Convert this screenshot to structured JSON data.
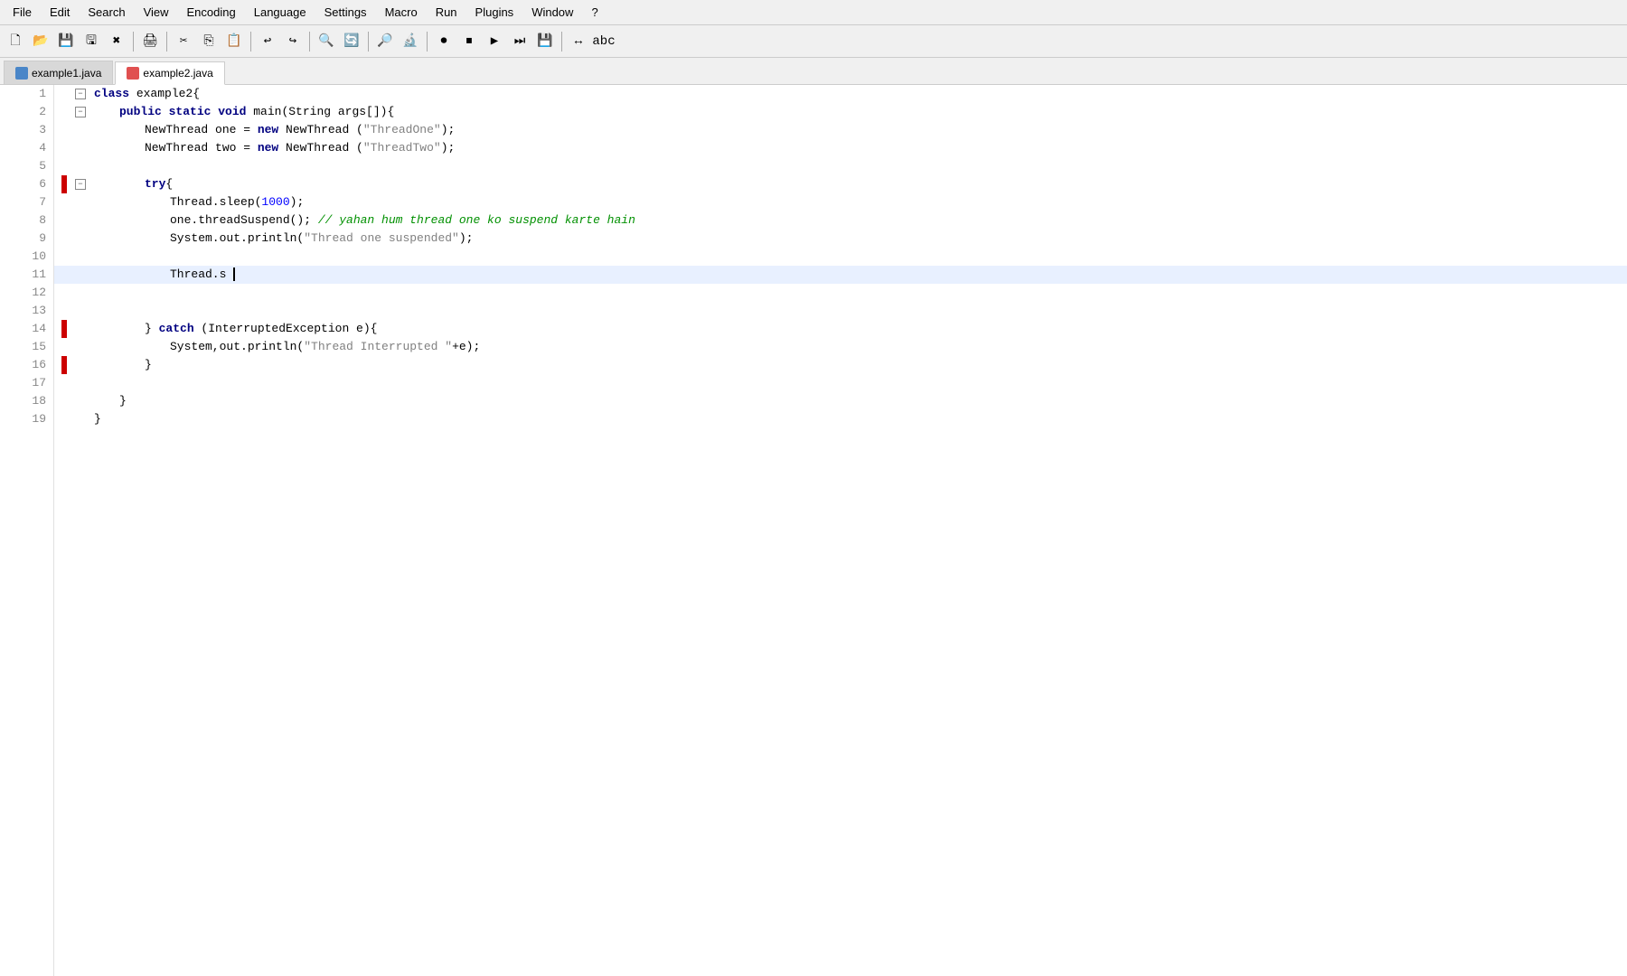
{
  "menubar": {
    "items": [
      "File",
      "Edit",
      "Search",
      "View",
      "Encoding",
      "Language",
      "Settings",
      "Macro",
      "Run",
      "Plugins",
      "Window",
      "?"
    ]
  },
  "toolbar": {
    "buttons": [
      {
        "name": "new",
        "icon": "🗋"
      },
      {
        "name": "open",
        "icon": "📂"
      },
      {
        "name": "save",
        "icon": "💾"
      },
      {
        "name": "save-all",
        "icon": "🖫"
      },
      {
        "name": "close",
        "icon": "✕"
      },
      {
        "sep": true
      },
      {
        "name": "print",
        "icon": "🖨"
      },
      {
        "sep": true
      },
      {
        "name": "cut",
        "icon": "✂"
      },
      {
        "name": "copy",
        "icon": "📋"
      },
      {
        "name": "paste",
        "icon": "📌"
      },
      {
        "sep": true
      },
      {
        "name": "undo",
        "icon": "↩"
      },
      {
        "name": "redo",
        "icon": "↪"
      },
      {
        "sep": true
      },
      {
        "name": "find",
        "icon": "🔍"
      },
      {
        "name": "replace",
        "icon": "🔄"
      },
      {
        "sep": true
      },
      {
        "name": "zoom-in",
        "icon": "🔎"
      },
      {
        "name": "zoom-out",
        "icon": "🔍"
      },
      {
        "sep": true
      },
      {
        "name": "record-macro",
        "icon": "⏺"
      },
      {
        "name": "stop-macro",
        "icon": "⏹"
      },
      {
        "name": "play-macro",
        "icon": "▶"
      },
      {
        "name": "run-macro",
        "icon": "⏭"
      },
      {
        "name": "save-macro",
        "icon": "💾"
      },
      {
        "sep": true
      },
      {
        "name": "sync-scroll",
        "icon": "↔"
      },
      {
        "name": "abc",
        "icon": "abc"
      }
    ]
  },
  "tabs": [
    {
      "label": "example1.java",
      "active": false,
      "icon": "java"
    },
    {
      "label": "example2.java",
      "active": true,
      "icon": "java2"
    }
  ],
  "code": {
    "lines": [
      {
        "num": 1,
        "indent": 0,
        "foldable": true,
        "foldType": "minus",
        "hasRedMarker": false,
        "content": [
          {
            "type": "kw",
            "text": "class "
          },
          {
            "type": "plain",
            "text": "example2{"
          }
        ]
      },
      {
        "num": 2,
        "indent": 1,
        "foldable": true,
        "foldType": "minus",
        "hasRedMarker": false,
        "content": [
          {
            "type": "kw",
            "text": "public static void "
          },
          {
            "type": "plain",
            "text": "main(String args[]){"
          }
        ]
      },
      {
        "num": 3,
        "indent": 2,
        "foldable": false,
        "hasRedMarker": false,
        "content": [
          {
            "type": "plain",
            "text": "NewThread one = "
          },
          {
            "type": "kw",
            "text": "new "
          },
          {
            "type": "plain",
            "text": "NewThread ("
          },
          {
            "type": "str",
            "text": "\"ThreadOne\""
          },
          {
            "type": "plain",
            "text": ");"
          }
        ]
      },
      {
        "num": 4,
        "indent": 2,
        "foldable": false,
        "hasRedMarker": false,
        "content": [
          {
            "type": "plain",
            "text": "NewThread two = "
          },
          {
            "type": "kw",
            "text": "new "
          },
          {
            "type": "plain",
            "text": "NewThread ("
          },
          {
            "type": "str",
            "text": "\"ThreadTwo\""
          },
          {
            "type": "plain",
            "text": ");"
          }
        ]
      },
      {
        "num": 5,
        "indent": 0,
        "foldable": false,
        "hasRedMarker": false,
        "content": []
      },
      {
        "num": 6,
        "indent": 2,
        "foldable": true,
        "foldType": "minus",
        "hasRedMarker": true,
        "content": [
          {
            "type": "kw",
            "text": "try"
          },
          {
            "type": "plain",
            "text": "{"
          }
        ]
      },
      {
        "num": 7,
        "indent": 3,
        "foldable": false,
        "hasRedMarker": false,
        "content": [
          {
            "type": "plain",
            "text": "Thread.sleep("
          },
          {
            "type": "num",
            "text": "1000"
          },
          {
            "type": "plain",
            "text": ");"
          }
        ]
      },
      {
        "num": 8,
        "indent": 3,
        "foldable": false,
        "hasRedMarker": false,
        "content": [
          {
            "type": "plain",
            "text": "one.threadSuspend(); "
          },
          {
            "type": "comment",
            "text": "// yahan hum thread one ko suspend karte hain"
          }
        ]
      },
      {
        "num": 9,
        "indent": 3,
        "foldable": false,
        "hasRedMarker": false,
        "content": [
          {
            "type": "plain",
            "text": "System.out.println("
          },
          {
            "type": "str",
            "text": "\"Thread one suspended\""
          },
          {
            "type": "plain",
            "text": ");"
          }
        ]
      },
      {
        "num": 10,
        "indent": 0,
        "foldable": false,
        "hasRedMarker": false,
        "content": []
      },
      {
        "num": 11,
        "indent": 3,
        "foldable": false,
        "hasRedMarker": false,
        "active": true,
        "content": [
          {
            "type": "plain",
            "text": "Thread.s"
          }
        ]
      },
      {
        "num": 12,
        "indent": 0,
        "foldable": false,
        "hasRedMarker": false,
        "content": []
      },
      {
        "num": 13,
        "indent": 0,
        "foldable": false,
        "hasRedMarker": false,
        "content": []
      },
      {
        "num": 14,
        "indent": 2,
        "foldable": false,
        "hasRedMarker": true,
        "content": [
          {
            "type": "plain",
            "text": "} "
          },
          {
            "type": "kw",
            "text": "catch "
          },
          {
            "type": "plain",
            "text": "(InterruptedException e){"
          }
        ]
      },
      {
        "num": 15,
        "indent": 3,
        "foldable": false,
        "hasRedMarker": false,
        "content": [
          {
            "type": "plain",
            "text": "System,out.println("
          },
          {
            "type": "str",
            "text": "\"Thread Interrupted \""
          },
          {
            "type": "plain",
            "text": "+e);"
          }
        ]
      },
      {
        "num": 16,
        "indent": 2,
        "foldable": false,
        "hasRedMarker": true,
        "content": [
          {
            "type": "plain",
            "text": "}"
          }
        ]
      },
      {
        "num": 17,
        "indent": 0,
        "foldable": false,
        "hasRedMarker": false,
        "content": []
      },
      {
        "num": 18,
        "indent": 1,
        "foldable": false,
        "hasRedMarker": false,
        "content": [
          {
            "type": "plain",
            "text": "}"
          }
        ]
      },
      {
        "num": 19,
        "indent": 0,
        "foldable": false,
        "hasRedMarker": false,
        "content": [
          {
            "type": "plain",
            "text": "}"
          }
        ]
      }
    ],
    "indentSize": 4
  }
}
